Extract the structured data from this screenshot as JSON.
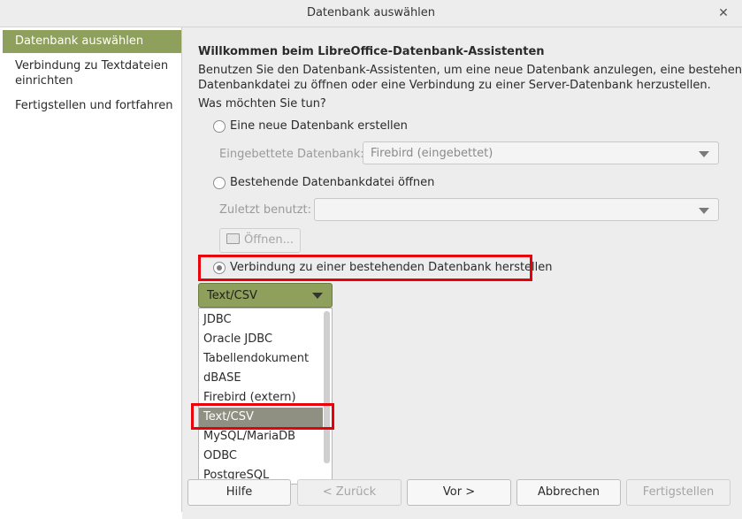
{
  "window": {
    "title": "Datenbank auswählen"
  },
  "sidebar": {
    "items": [
      {
        "label": "Datenbank auswählen"
      },
      {
        "label": "Verbindung zu Textdateien einrichten"
      },
      {
        "label": "Fertigstellen und fortfahren"
      }
    ]
  },
  "main": {
    "heading": "Willkommen beim LibreOffice-Datenbank-Assistenten",
    "intro_line1": "Benutzen Sie den Datenbank-Assistenten, um eine neue Datenbank anzulegen, eine bestehende",
    "intro_line2": "Datenbankdatei zu öffnen oder eine Verbindung zu einer Server-Datenbank herzustellen.",
    "question": "Was möchten Sie tun?",
    "option_new": "Eine neue Datenbank erstellen",
    "embedded_label": "Eingebettete Datenbank:",
    "embedded_value": "Firebird (eingebettet)",
    "option_open": "Bestehende Datenbankdatei öffnen",
    "recent_label": "Zuletzt benutzt:",
    "recent_value": "",
    "open_button": "Öffnen...",
    "option_connect": "Verbindung zu einer bestehenden Datenbank herstellen",
    "connection_type_selected": "Text/CSV",
    "connection_types": [
      "JDBC",
      "Oracle JDBC",
      "Tabellendokument",
      "dBASE",
      "Firebird (extern)",
      "Text/CSV",
      "MySQL/MariaDB",
      "ODBC",
      "PostgreSQL"
    ]
  },
  "footer": {
    "help": "Hilfe",
    "back": "< Zurück",
    "next": "Vor >",
    "cancel": "Abbrechen",
    "finish": "Fertigstellen"
  },
  "colors": {
    "accent": "#8ea05b",
    "highlight": "#e8000b",
    "list_selected": "#8f8f82"
  }
}
